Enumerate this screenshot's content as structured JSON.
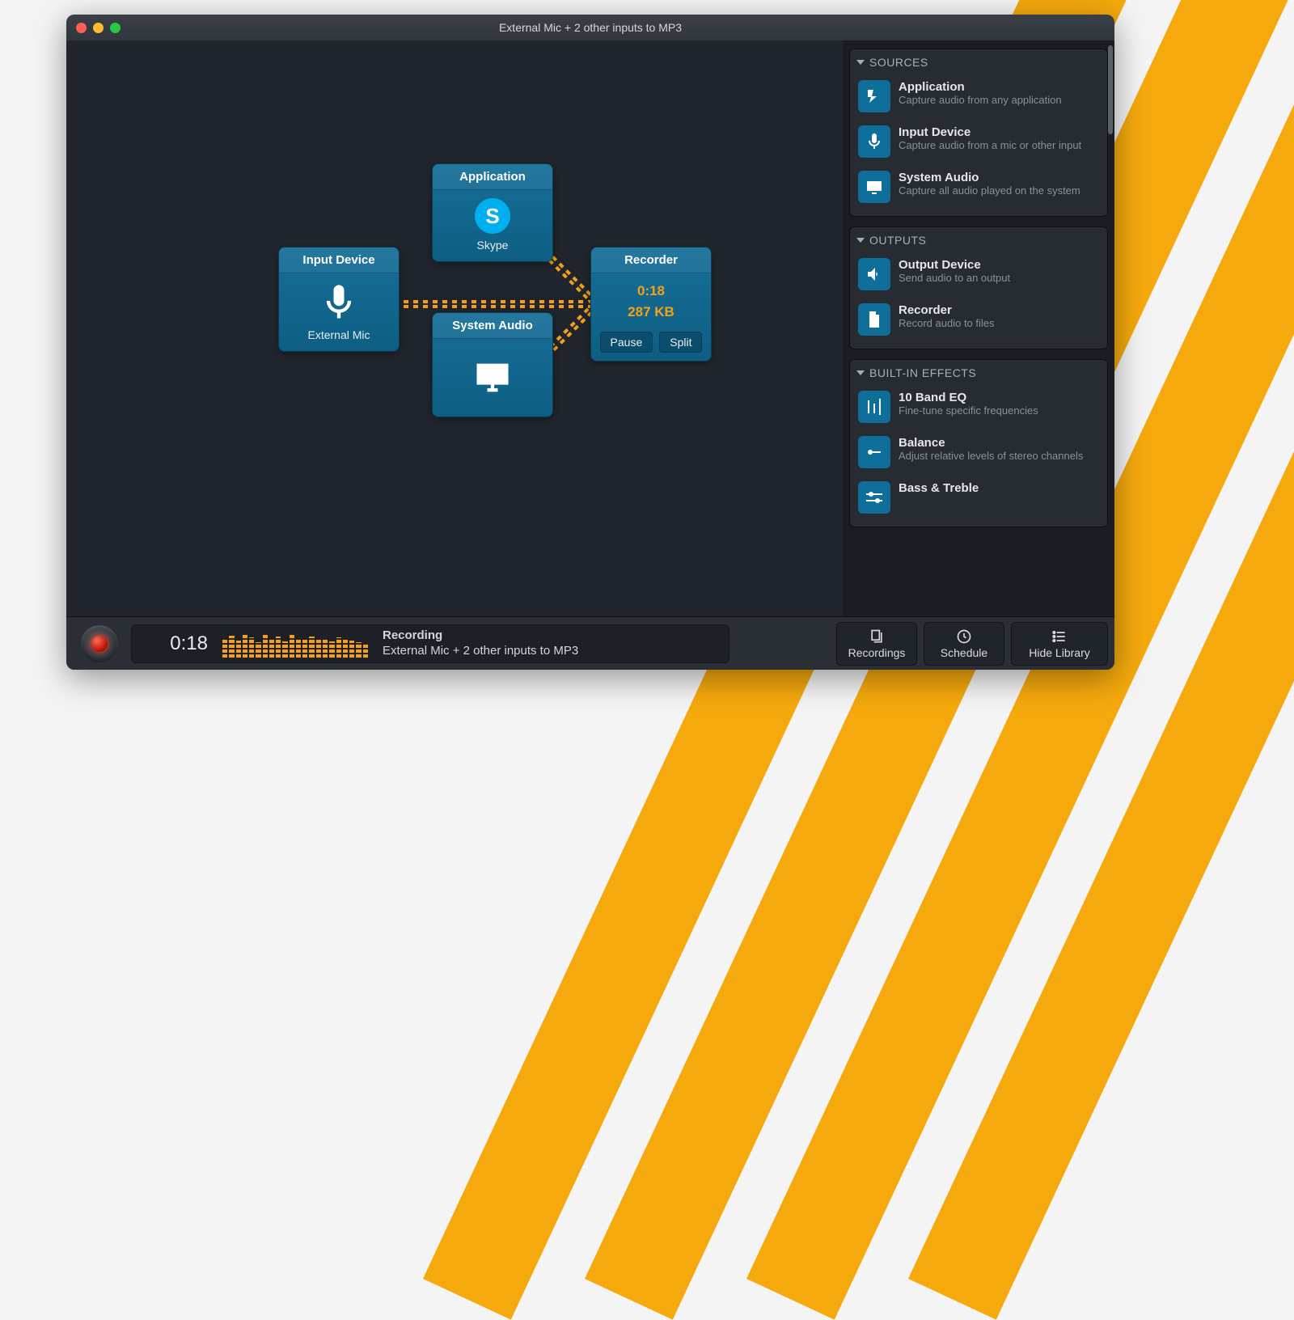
{
  "window": {
    "title": "External Mic + 2 other inputs to MP3"
  },
  "canvas": {
    "input_device": {
      "title": "Input Device",
      "label": "External Mic"
    },
    "application": {
      "title": "Application",
      "label": "Skype"
    },
    "system_audio": {
      "title": "System Audio"
    },
    "recorder": {
      "title": "Recorder",
      "time": "0:18",
      "size": "287 KB",
      "pause": "Pause",
      "split": "Split"
    }
  },
  "sidebar": {
    "sources": {
      "heading": "SOURCES",
      "items": [
        {
          "title": "Application",
          "desc": "Capture audio from any application"
        },
        {
          "title": "Input Device",
          "desc": "Capture audio from a mic or other input"
        },
        {
          "title": "System Audio",
          "desc": "Capture all audio played on the system"
        }
      ]
    },
    "outputs": {
      "heading": "OUTPUTS",
      "items": [
        {
          "title": "Output Device",
          "desc": "Send audio to an output"
        },
        {
          "title": "Recorder",
          "desc": "Record audio to files"
        }
      ]
    },
    "effects": {
      "heading": "BUILT-IN EFFECTS",
      "items": [
        {
          "title": "10 Band EQ",
          "desc": "Fine-tune specific frequencies"
        },
        {
          "title": "Balance",
          "desc": "Adjust relative levels of stereo channels"
        },
        {
          "title": "Bass & Treble",
          "desc": ""
        }
      ]
    }
  },
  "footer": {
    "time": "0:18",
    "status_title": "Recording",
    "status_detail": "External Mic + 2 other inputs to MP3",
    "recordings": "Recordings",
    "schedule": "Schedule",
    "hide_library": "Hide Library"
  }
}
